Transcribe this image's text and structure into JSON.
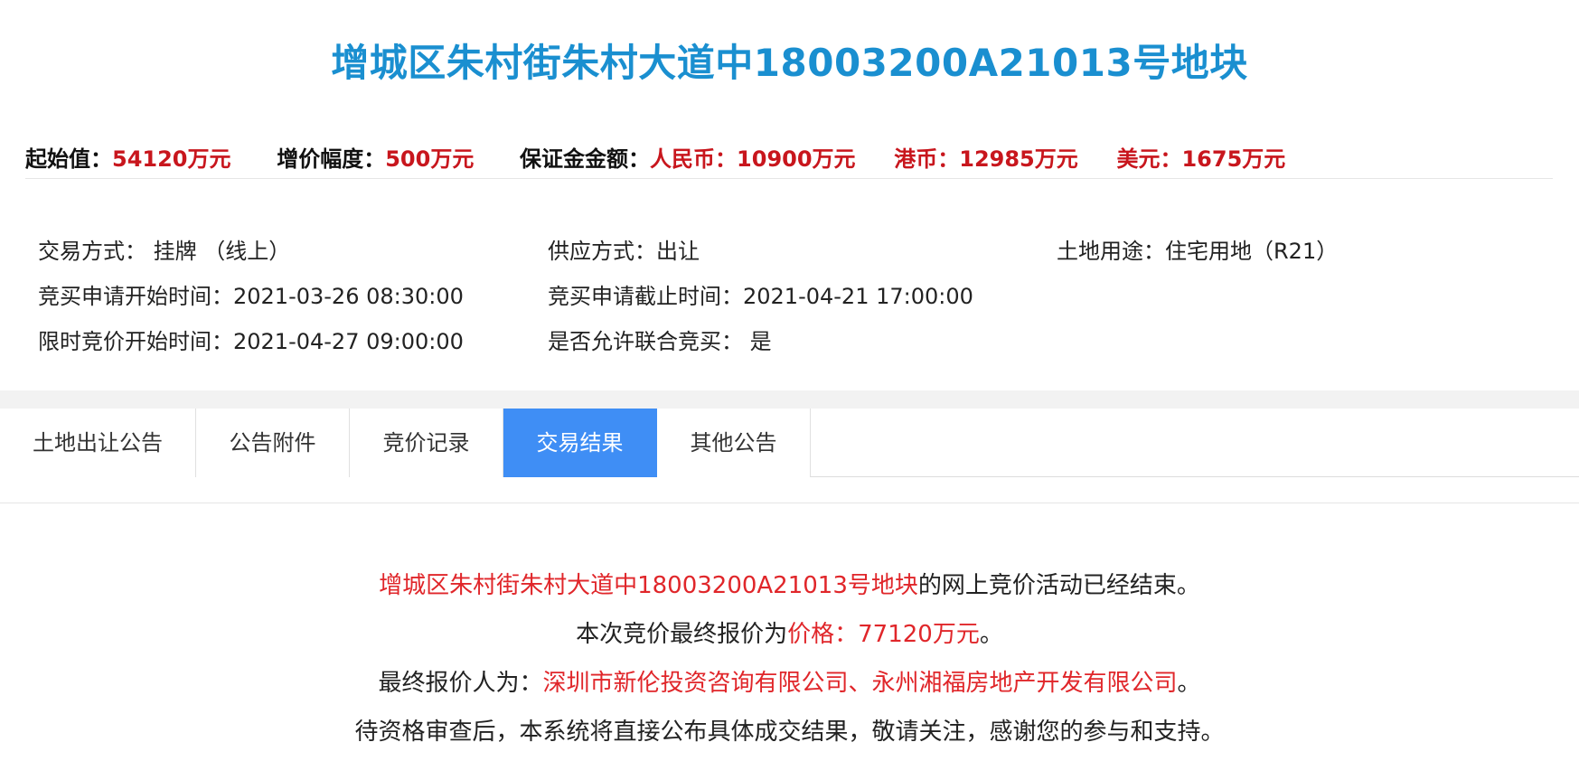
{
  "title": "增城区朱村街朱村大道中18003200A21013号地块",
  "price_bar": {
    "start_label": "起始值：",
    "start_value": "54120万元",
    "increment_label": "增价幅度：",
    "increment_value": "500万元",
    "deposit_label": "保证金金额：",
    "rmb_value": "人民币：10900万元",
    "hkd_value": "港币：12985万元",
    "usd_value": "美元：1675万元"
  },
  "info": {
    "trade_method": "交易方式：  挂牌 （线上）",
    "supply_method": "供应方式：出让",
    "land_use": "土地用途：住宅用地（R21）",
    "apply_start": "竞买申请开始时间：2021-03-26 08:30:00",
    "apply_end": "竞买申请截止时间：2021-04-21 17:00:00",
    "bid_start": "限时竞价开始时间：2021-04-27 09:00:00",
    "joint_bid": "是否允许联合竞买：  是"
  },
  "tabs": [
    {
      "label": "土地出让公告",
      "active": false
    },
    {
      "label": "公告附件",
      "active": false
    },
    {
      "label": "竞价记录",
      "active": false
    },
    {
      "label": "交易结果",
      "active": true
    },
    {
      "label": "其他公告",
      "active": false
    }
  ],
  "result": {
    "line1_parcel": "增城区朱村街朱村大道中18003200A21013号地块",
    "line1_suffix": "的网上竞价活动已经结束。",
    "line2_prefix": "本次竞价最终报价为",
    "line2_price": "价格：77120万元",
    "line2_suffix": "。",
    "line3_prefix": "最终报价人为：",
    "line3_bidders": "深圳市新伦投资咨询有限公司、永州湘福房地产开发有限公司",
    "line3_suffix": "。",
    "line4": "待资格审查后，本系统将直接公布具体成交结果，敬请关注，感谢您的参与和支持。"
  },
  "colors": {
    "title": "#1a8fd0",
    "price_red": "#c8161d",
    "tab_active": "#3f8ef5",
    "result_red": "#e0262a"
  }
}
